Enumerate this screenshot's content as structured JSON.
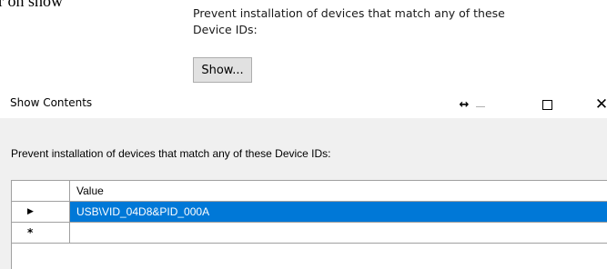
{
  "background": {
    "partial_text": "r on show",
    "prevent_label": "Prevent installation of devices that match any of these Device IDs:",
    "show_button_label": "Show..."
  },
  "dialog": {
    "title": "Show Contents",
    "controls": {
      "resize_icon": "↔",
      "minimize_icon": "minimize-icon",
      "maximize_icon": "maximize-icon",
      "close_icon": "✕"
    },
    "label": "Prevent installation of devices that match any of these Device IDs:",
    "grid": {
      "header": {
        "value_column": "Value"
      },
      "rows": [
        {
          "selector": "▶",
          "value": "USB\\VID_04D8&PID_000A",
          "selected": true
        },
        {
          "selector": "*",
          "value": ""
        }
      ]
    }
  },
  "colors": {
    "selection": "#0078d7",
    "button_bg": "#e1e1e1",
    "dialog_bg": "#f0f0f0"
  }
}
